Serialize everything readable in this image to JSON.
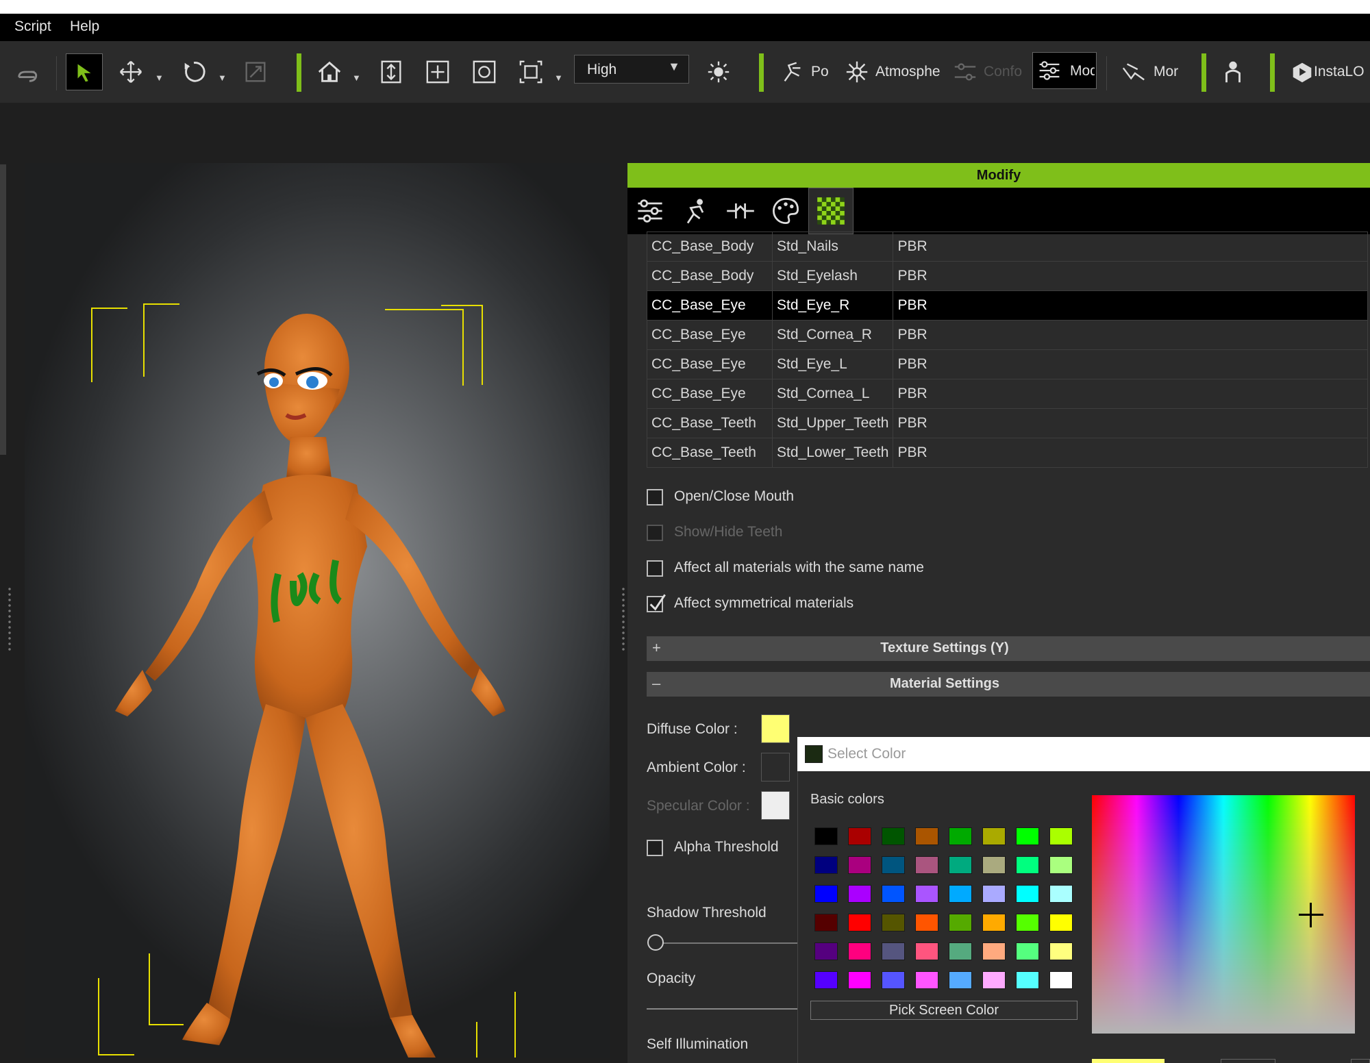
{
  "menu": [
    "Script",
    "Help"
  ],
  "toolbar": {
    "quality": "High",
    "labels": [
      "Po",
      "Atmosphe",
      "Confo",
      "Mod",
      "Mor",
      "InstaLO"
    ]
  },
  "modify": {
    "header": "Modify",
    "materials": [
      [
        "CC_Base_Body",
        "Std_Nails",
        "PBR"
      ],
      [
        "CC_Base_Body",
        "Std_Eyelash",
        "PBR"
      ],
      [
        "CC_Base_Eye",
        "Std_Eye_R",
        "PBR"
      ],
      [
        "CC_Base_Eye",
        "Std_Cornea_R",
        "PBR"
      ],
      [
        "CC_Base_Eye",
        "Std_Eye_L",
        "PBR"
      ],
      [
        "CC_Base_Eye",
        "Std_Cornea_L",
        "PBR"
      ],
      [
        "CC_Base_Teeth",
        "Std_Upper_Teeth",
        "PBR"
      ],
      [
        "CC_Base_Teeth",
        "Std_Lower_Teeth",
        "PBR"
      ]
    ],
    "selected_row": 2,
    "checkboxes": [
      {
        "label": "Open/Close Mouth",
        "checked": false,
        "disabled": false
      },
      {
        "label": "Show/Hide Teeth",
        "checked": false,
        "disabled": true
      },
      {
        "label": "Affect all materials with the same name",
        "checked": false,
        "disabled": false
      },
      {
        "label": "Affect symmetrical materials",
        "checked": true,
        "disabled": false
      }
    ],
    "texture_settings": {
      "sign": "+",
      "title": "Texture Settings  (Y)"
    },
    "material_settings": {
      "sign": "–",
      "title": "Material Settings"
    },
    "diffuse_label": "Diffuse Color :",
    "diffuse_color": "#ffff73",
    "ambient_label": "Ambient Color :",
    "ambient_color": "#2b2b2b",
    "specular_label": "Specular Color :",
    "specular_color": "#eeeeee",
    "alpha_threshold": "Alpha Threshold",
    "shadow_threshold": "Shadow Threshold",
    "opacity": "Opacity",
    "self_illumination": "Self Illumination"
  },
  "select_color": {
    "title": "Select Color",
    "basic_colors_label": "Basic colors",
    "basic_colors": [
      [
        "#000000",
        "#aa0000",
        "#005500",
        "#aa5500",
        "#00aa00",
        "#aaaa00",
        "#00ff00",
        "#aaff00"
      ],
      [
        "#00007f",
        "#aa007f",
        "#00557f",
        "#aa557f",
        "#00aa7f",
        "#aaaa7f",
        "#00ff7f",
        "#aaff7f"
      ],
      [
        "#0000ff",
        "#aa00ff",
        "#0055ff",
        "#aa55ff",
        "#00aaff",
        "#aaaaff",
        "#00ffff",
        "#aaffff"
      ],
      [
        "#550000",
        "#ff0000",
        "#555500",
        "#ff5500",
        "#55aa00",
        "#ffaa00",
        "#55ff00",
        "#ffff00"
      ],
      [
        "#55007f",
        "#ff007f",
        "#55557f",
        "#ff557f",
        "#55aa7f",
        "#ffaa7f",
        "#55ff7f",
        "#ffff7f"
      ],
      [
        "#5500ff",
        "#ff00ff",
        "#5555ff",
        "#ff55ff",
        "#55aaff",
        "#ffaaff",
        "#55ffff",
        "#ffffff"
      ]
    ],
    "pick_screen_color": "Pick Screen Color"
  }
}
